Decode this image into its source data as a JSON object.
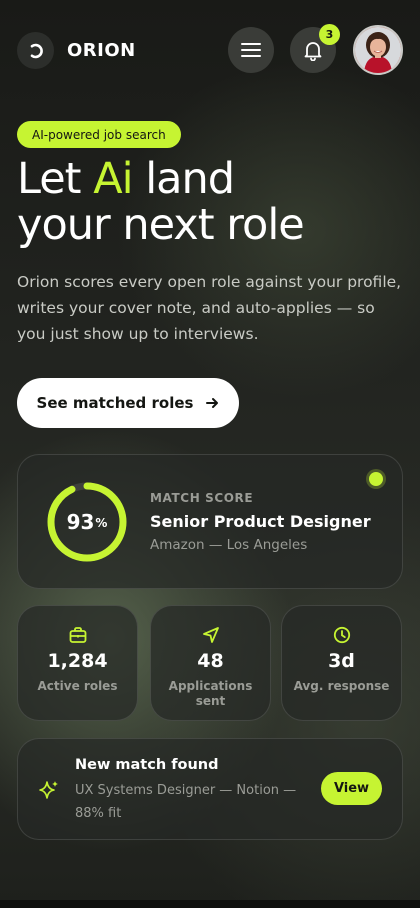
{
  "header": {
    "brand": "ORION",
    "notification_count": "3",
    "icons": {
      "logo": "orion-logo-icon",
      "menu": "menu-icon",
      "bell": "bell-icon",
      "avatar": "user-avatar"
    }
  },
  "hero": {
    "pill": "AI-powered job search",
    "headline_part1": "Let ",
    "headline_accent": "Ai",
    "headline_part2": " land",
    "headline_line2": "your next role",
    "subtitle": "Orion scores every open role against your profile, writes your cover note, and auto-applies — so you just show up to interviews.",
    "cta_label": "See matched roles",
    "cta_icon": "arrow-right-icon"
  },
  "match": {
    "score_value": "93",
    "score_unit": "%",
    "score_fraction": 0.93,
    "label": "MATCH SCORE",
    "title": "Senior Product Designer",
    "subtitle": "Amazon — Los Angeles"
  },
  "stats": [
    {
      "icon": "briefcase-icon",
      "value": "1,284",
      "label": "Active roles"
    },
    {
      "icon": "send-icon",
      "value": "48",
      "label": "Applications sent"
    },
    {
      "icon": "clock-icon",
      "value": "3d",
      "label": "Avg. response"
    }
  ],
  "notification": {
    "icon": "sparkle-icon",
    "title": "New match found",
    "subtitle": "UX Systems Designer — Notion — 88% fit",
    "action": "View"
  },
  "colors": {
    "accent": "#c6f432",
    "background": "#1e201c",
    "card": "#262825",
    "muted_text": "#9a9c96"
  }
}
